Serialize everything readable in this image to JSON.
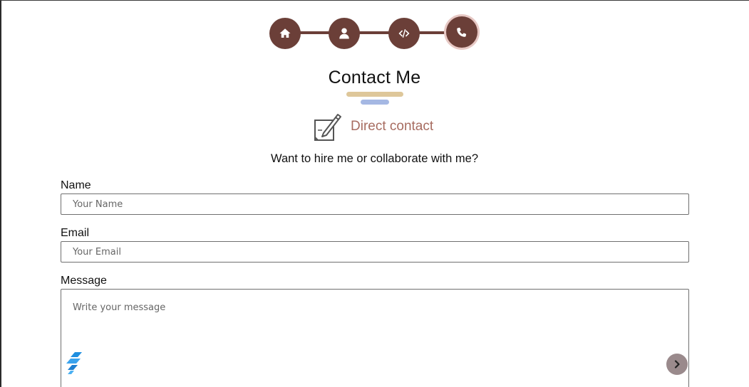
{
  "nav": {
    "steps": [
      {
        "icon": "home-icon",
        "active": false
      },
      {
        "icon": "user-icon",
        "active": false
      },
      {
        "icon": "code-icon",
        "active": false
      },
      {
        "icon": "phone-icon",
        "active": true
      }
    ],
    "color": "#6b3f38",
    "active_ring_color": "#e7c8c4"
  },
  "section": {
    "title": "Contact Me",
    "subtitle": "Direct contact",
    "subtitle_icon": "edit-note-icon",
    "question": "Want to hire me or collaborate with me?",
    "accent_gold": "#dec79a",
    "accent_blue": "#a5b8e3",
    "subtitle_color": "#a76c60"
  },
  "form": {
    "name_label": "Name",
    "name_placeholder": "Your Name",
    "name_value": "",
    "email_label": "Email",
    "email_placeholder": "Your Email",
    "email_value": "",
    "message_label": "Message",
    "message_placeholder": "Write your message",
    "message_value": ""
  },
  "widgets": {
    "logo_icon": "brand-logo-icon",
    "scroll_button_icon": "chevron-right-icon"
  }
}
